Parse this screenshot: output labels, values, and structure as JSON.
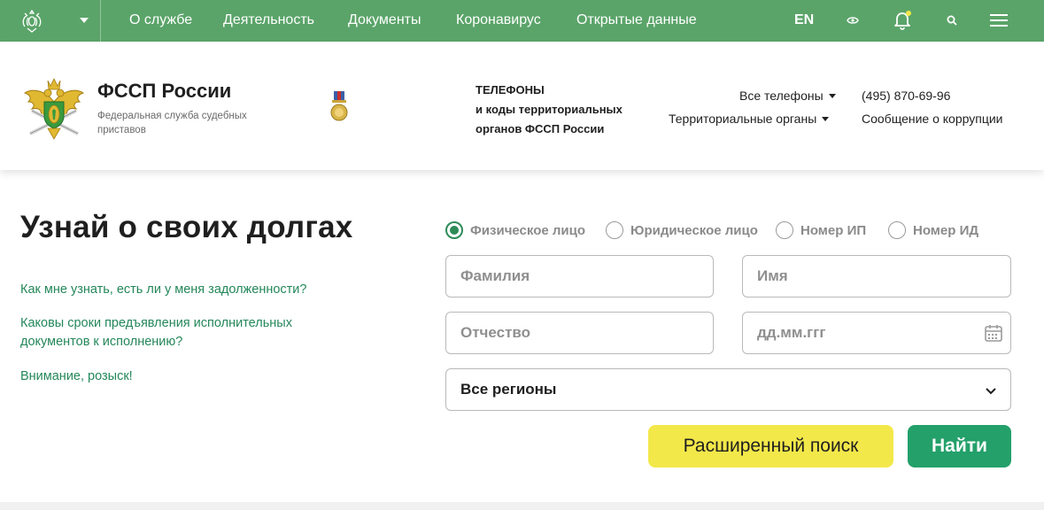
{
  "topnav": {
    "items": [
      "О службе",
      "Деятельность",
      "Документы",
      "Коронавирус",
      "Открытые данные"
    ],
    "lang": "EN",
    "icons": [
      "eye-icon",
      "bell-icon",
      "search-icon",
      "menu-icon"
    ],
    "bg_color": "#5aa469",
    "notify_dot_color": "#f3e84a"
  },
  "header": {
    "brand_title": "ФССП России",
    "brand_subtitle": "Федеральная служба судебных приставов",
    "phones_title_lines": [
      "ТЕЛЕФОНЫ",
      "и коды территориальных",
      "органов ФССП России"
    ],
    "all_phones": "Все телефоны",
    "territorial": "Территориальные органы",
    "phone": "(495) 870-69-96",
    "corruption": "Сообщение о коррупции"
  },
  "main": {
    "title": "Узнай о своих долгах",
    "faq": [
      "Как мне узнать, есть ли у меня задолженности?",
      "Каковы сроки предъявления исполнительных документов к исполнению?",
      "Внимание, розыск!"
    ]
  },
  "search": {
    "radios": [
      {
        "label": "Физическое лицо",
        "checked": true
      },
      {
        "label": "Юридическое лицо",
        "checked": false
      },
      {
        "label": "Номер ИП",
        "checked": false
      },
      {
        "label": "Номер ИД",
        "checked": false
      }
    ],
    "lastname_placeholder": "Фамилия",
    "firstname_placeholder": "Имя",
    "patronymic_placeholder": "Отчество",
    "date_placeholder": "дд.мм.ггг",
    "region_value": "Все регионы",
    "advanced_label": "Расширенный поиск",
    "find_label": "Найти",
    "accent_green": "#24a06a",
    "accent_yellow": "#f3e84a"
  }
}
